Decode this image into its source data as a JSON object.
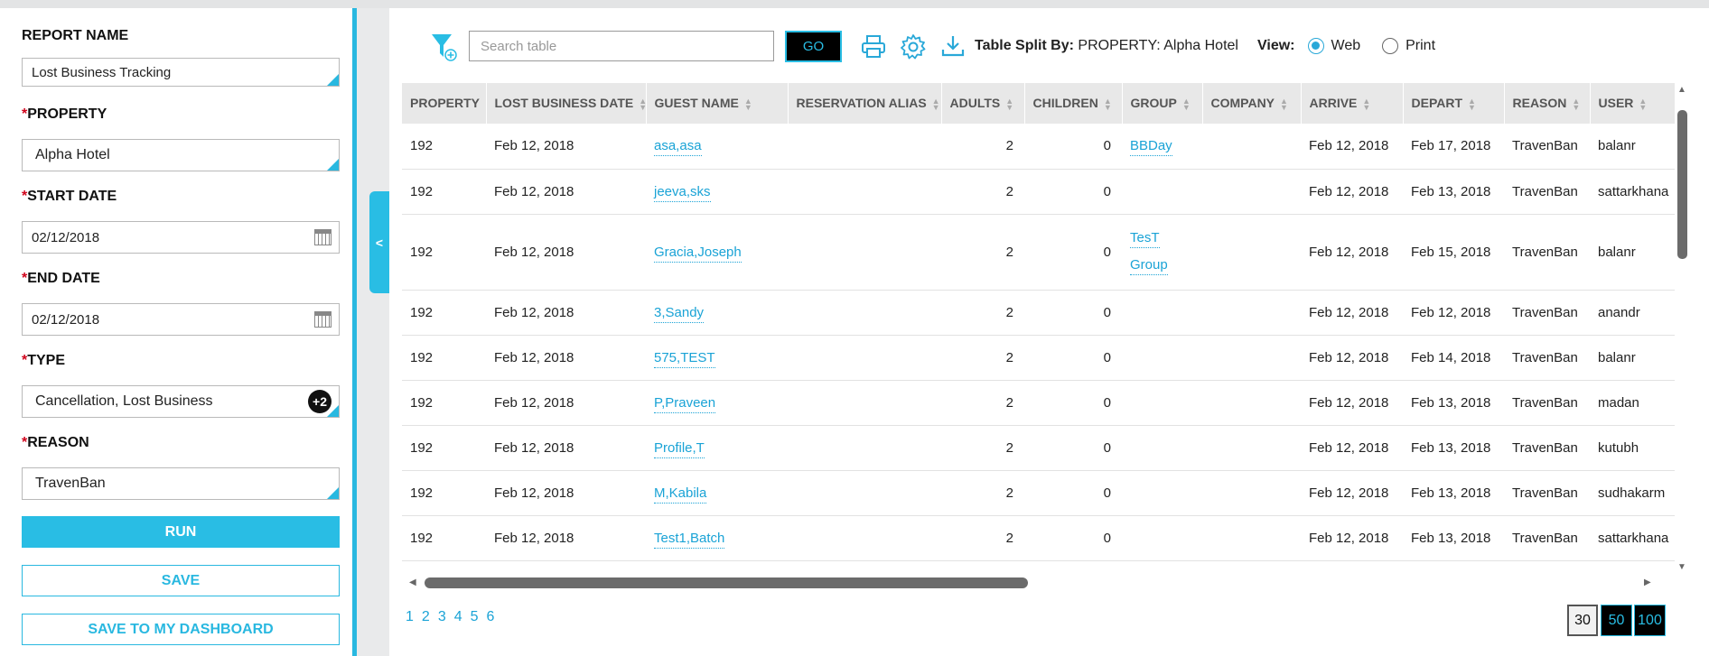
{
  "filters": {
    "report_name_label": "REPORT NAME",
    "report_name_value": "Lost Business Tracking",
    "property_label": "PROPERTY",
    "property_value": "Alpha Hotel",
    "start_date_label": "START DATE",
    "start_date_value": "02/12/2018",
    "end_date_label": "END DATE",
    "end_date_value": "02/12/2018",
    "type_label": "TYPE",
    "type_value": "Cancellation, Lost Business",
    "type_more": "+2",
    "reason_label": "REASON",
    "reason_value": "TravenBan",
    "required_mark": "*",
    "run_label": "RUN",
    "save_label": "SAVE",
    "save_dashboard_label": "SAVE TO MY DASHBOARD",
    "collapse_glyph": "<"
  },
  "toolbar": {
    "search_placeholder": "Search table",
    "go_label": "GO",
    "split_label": "Table Split By:",
    "split_value": "PROPERTY: Alpha Hotel",
    "view_label": "View:",
    "view_web": "Web",
    "view_print": "Print",
    "view_selected": "Web",
    "icons": [
      "filter-icon",
      "print-icon",
      "gear-icon",
      "download-icon"
    ]
  },
  "table": {
    "columns": [
      "PROPERTY",
      "LOST BUSINESS DATE",
      "GUEST NAME",
      "RESERVATION ALIAS",
      "ADULTS",
      "CHILDREN",
      "GROUP",
      "COMPANY",
      "ARRIVE",
      "DEPART",
      "REASON",
      "USER"
    ],
    "rows": [
      {
        "property": "192",
        "date": "Feb 12, 2018",
        "guest": "asa,asa",
        "alias": "",
        "adults": "2",
        "children": "0",
        "group": [
          "BBDay"
        ],
        "company": "",
        "arrive": "Feb 12, 2018",
        "depart": "Feb 17, 2018",
        "reason": "TravenBan",
        "user": "balanr"
      },
      {
        "property": "192",
        "date": "Feb 12, 2018",
        "guest": "jeeva,sks",
        "alias": "",
        "adults": "2",
        "children": "0",
        "group": [],
        "company": "",
        "arrive": "Feb 12, 2018",
        "depart": "Feb 13, 2018",
        "reason": "TravenBan",
        "user": "sattarkhana"
      },
      {
        "property": "192",
        "date": "Feb 12, 2018",
        "guest": "Gracia,Joseph",
        "alias": "",
        "adults": "2",
        "children": "0",
        "group": [
          "TesT",
          "Group"
        ],
        "company": "",
        "arrive": "Feb 12, 2018",
        "depart": "Feb 15, 2018",
        "reason": "TravenBan",
        "user": "balanr"
      },
      {
        "property": "192",
        "date": "Feb 12, 2018",
        "guest": "3,Sandy",
        "alias": "",
        "adults": "2",
        "children": "0",
        "group": [],
        "company": "",
        "arrive": "Feb 12, 2018",
        "depart": "Feb 12, 2018",
        "reason": "TravenBan",
        "user": "anandr"
      },
      {
        "property": "192",
        "date": "Feb 12, 2018",
        "guest": "575,TEST",
        "alias": "",
        "adults": "2",
        "children": "0",
        "group": [],
        "company": "",
        "arrive": "Feb 12, 2018",
        "depart": "Feb 14, 2018",
        "reason": "TravenBan",
        "user": "balanr"
      },
      {
        "property": "192",
        "date": "Feb 12, 2018",
        "guest": "P,Praveen",
        "alias": "",
        "adults": "2",
        "children": "0",
        "group": [],
        "company": "",
        "arrive": "Feb 12, 2018",
        "depart": "Feb 13, 2018",
        "reason": "TravenBan",
        "user": "madan"
      },
      {
        "property": "192",
        "date": "Feb 12, 2018",
        "guest": "Profile,T",
        "alias": "",
        "adults": "2",
        "children": "0",
        "group": [],
        "company": "",
        "arrive": "Feb 12, 2018",
        "depart": "Feb 13, 2018",
        "reason": "TravenBan",
        "user": "kutubh"
      },
      {
        "property": "192",
        "date": "Feb 12, 2018",
        "guest": "M,Kabila",
        "alias": "",
        "adults": "2",
        "children": "0",
        "group": [],
        "company": "",
        "arrive": "Feb 12, 2018",
        "depart": "Feb 13, 2018",
        "reason": "TravenBan",
        "user": "sudhakarm"
      },
      {
        "property": "192",
        "date": "Feb 12, 2018",
        "guest": "Test1,Batch",
        "alias": "",
        "adults": "2",
        "children": "0",
        "group": [],
        "company": "",
        "arrive": "Feb 12, 2018",
        "depart": "Feb 13, 2018",
        "reason": "TravenBan",
        "user": "sattarkhana"
      }
    ]
  },
  "pagination": {
    "pages": [
      "1",
      "2",
      "3",
      "4",
      "5",
      "6"
    ],
    "current_page": "1",
    "page_sizes": [
      "30",
      "50",
      "100"
    ],
    "selected_page_size": "30"
  },
  "colors": {
    "accent": "#29bde4",
    "link": "#1aa3d6",
    "required": "#d0021b"
  }
}
